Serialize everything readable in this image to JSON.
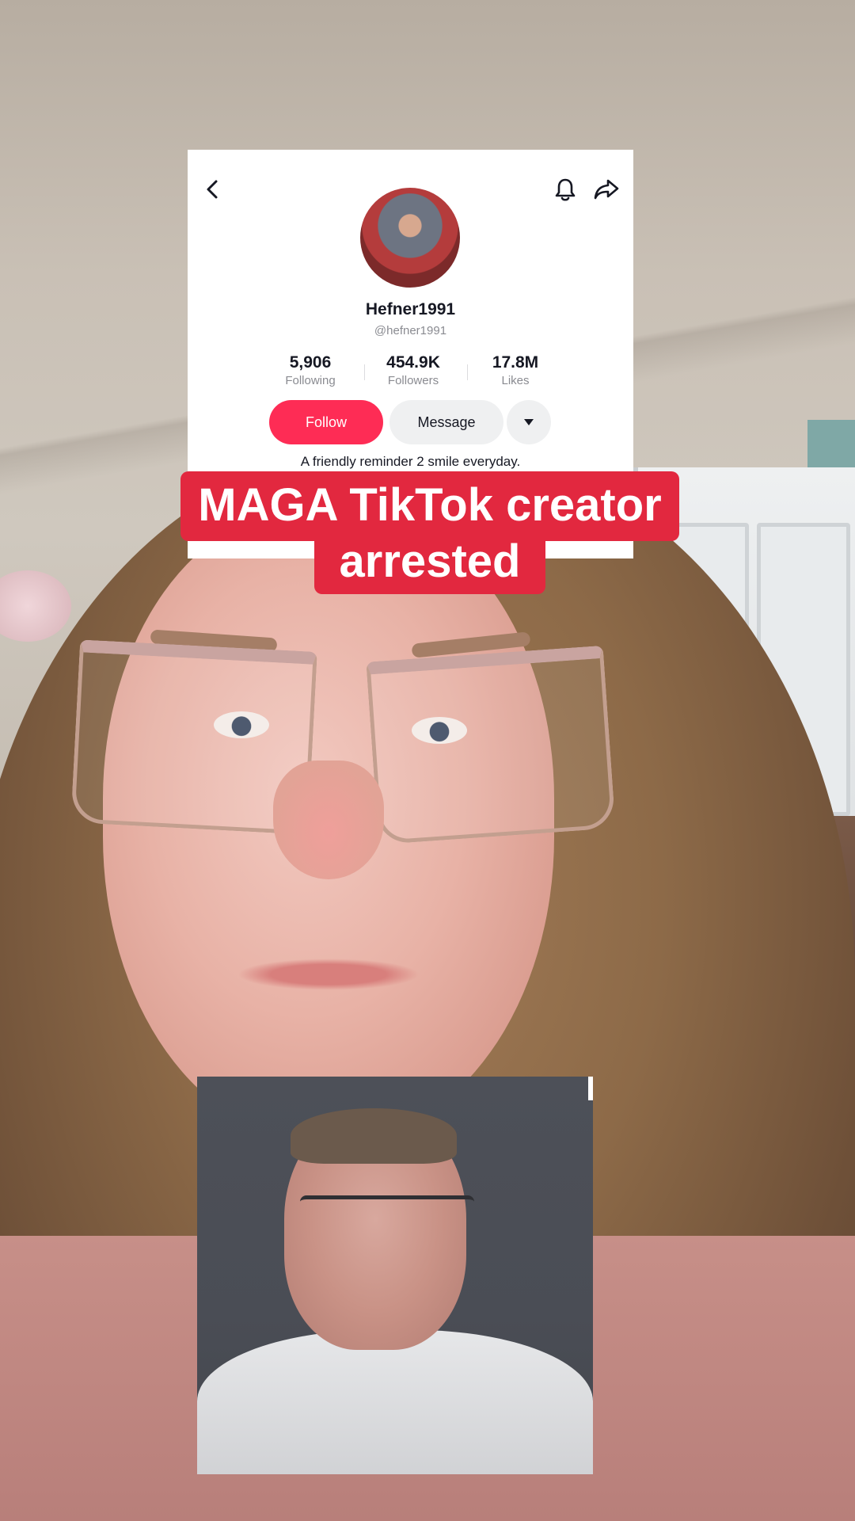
{
  "profile": {
    "username": "Hefner1991",
    "handle": "@hefner1991",
    "stats": [
      {
        "value": "5,906",
        "label": "Following"
      },
      {
        "value": "454.9K",
        "label": "Followers"
      },
      {
        "value": "17.8M",
        "label": "Likes"
      }
    ],
    "follow_label": "Follow",
    "message_label": "Message",
    "bio": "A friendly reminder 2 smile everyday.",
    "accent_color": "#fe2c55"
  },
  "caption": {
    "line1": "MAGA TikTok creator",
    "line2": "arrested",
    "background_color": "#e2283f"
  },
  "icons": [
    "back-arrow-icon",
    "bell-icon",
    "share-icon",
    "dropdown-arrow-icon"
  ]
}
